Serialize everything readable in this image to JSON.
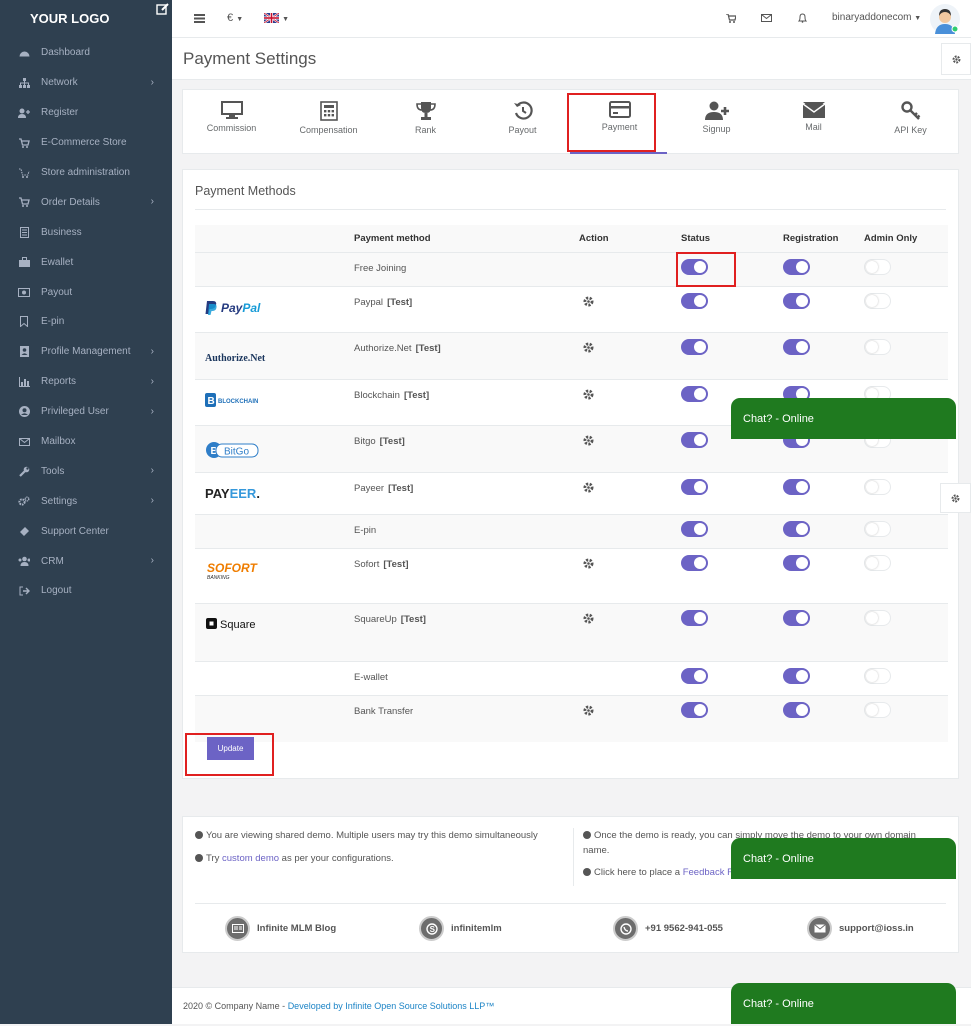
{
  "sidebar": {
    "logo": "YOUR LOGO",
    "items": [
      {
        "label": "Dashboard",
        "icon": "dashboard-icon",
        "chevron": false
      },
      {
        "label": "Network",
        "icon": "sitemap-icon",
        "chevron": true
      },
      {
        "label": "Register",
        "icon": "user-plus-icon",
        "chevron": false
      },
      {
        "label": "E-Commerce Store",
        "icon": "cart-icon",
        "chevron": false
      },
      {
        "label": "Store administration",
        "icon": "cart-arrow-icon",
        "chevron": false
      },
      {
        "label": "Order Details",
        "icon": "cart-icon",
        "chevron": true
      },
      {
        "label": "Business",
        "icon": "document-icon",
        "chevron": false
      },
      {
        "label": "Ewallet",
        "icon": "briefcase-icon",
        "chevron": false
      },
      {
        "label": "Payout",
        "icon": "money-icon",
        "chevron": false
      },
      {
        "label": "E-pin",
        "icon": "bookmark-icon",
        "chevron": false
      },
      {
        "label": "Profile Management",
        "icon": "id-card-icon",
        "chevron": true
      },
      {
        "label": "Reports",
        "icon": "bar-chart-icon",
        "chevron": true
      },
      {
        "label": "Privileged User",
        "icon": "user-circle-icon",
        "chevron": true
      },
      {
        "label": "Mailbox",
        "icon": "envelope-icon",
        "chevron": false
      },
      {
        "label": "Tools",
        "icon": "wrench-icon",
        "chevron": true
      },
      {
        "label": "Settings",
        "icon": "cogs-icon",
        "chevron": true
      },
      {
        "label": "Support Center",
        "icon": "ticket-icon",
        "chevron": false
      },
      {
        "label": "CRM",
        "icon": "users-icon",
        "chevron": true
      },
      {
        "label": "Logout",
        "icon": "sign-out-icon",
        "chevron": false
      }
    ]
  },
  "topbar": {
    "currency": "€",
    "username": "binaryaddonecom"
  },
  "page": {
    "title": "Payment Settings"
  },
  "tabs": [
    {
      "label": "Commission",
      "icon": "monitor-icon"
    },
    {
      "label": "Compensation",
      "icon": "calculator-icon"
    },
    {
      "label": "Rank",
      "icon": "trophy-icon"
    },
    {
      "label": "Payout",
      "icon": "history-icon"
    },
    {
      "label": "Payment",
      "icon": "credit-card-icon",
      "active": true
    },
    {
      "label": "Signup",
      "icon": "user-plus-icon"
    },
    {
      "label": "Mail",
      "icon": "envelope-icon"
    },
    {
      "label": "API Key",
      "icon": "key-icon"
    }
  ],
  "payment_methods": {
    "title": "Payment Methods",
    "columns": [
      "Payment method",
      "Action",
      "Status",
      "Registration",
      "Admin Only"
    ],
    "rows": [
      {
        "logo": "",
        "name": "Free Joining",
        "test": "",
        "gear": false,
        "status": true,
        "registration": true,
        "admin_only": false
      },
      {
        "logo": "PayPal",
        "name": "Paypal",
        "test": "[Test]",
        "gear": true,
        "status": true,
        "registration": true,
        "admin_only": false
      },
      {
        "logo": "Authorize.Net",
        "name": "Authorize.Net",
        "test": "[Test]",
        "gear": true,
        "status": true,
        "registration": true,
        "admin_only": false
      },
      {
        "logo": "BLOCKCHAIN",
        "name": "Blockchain",
        "test": "[Test]",
        "gear": true,
        "status": true,
        "registration": true,
        "admin_only": false
      },
      {
        "logo": "BitGo",
        "name": "Bitgo",
        "test": "[Test]",
        "gear": true,
        "status": true,
        "registration": true,
        "admin_only": false
      },
      {
        "logo": "PAYEER.",
        "name": "Payeer",
        "test": "[Test]",
        "gear": true,
        "status": true,
        "registration": true,
        "admin_only": false
      },
      {
        "logo": "",
        "name": "E-pin",
        "test": "",
        "gear": false,
        "status": true,
        "registration": true,
        "admin_only": false
      },
      {
        "logo": "SOFORT",
        "name": "Sofort",
        "test": "[Test]",
        "gear": true,
        "status": true,
        "registration": true,
        "admin_only": false
      },
      {
        "logo": "Square",
        "name": "SquareUp",
        "test": "[Test]",
        "gear": true,
        "status": true,
        "registration": true,
        "admin_only": false
      },
      {
        "logo": "",
        "name": "E-wallet",
        "test": "",
        "gear": false,
        "status": true,
        "registration": true,
        "admin_only": false
      },
      {
        "logo": "",
        "name": "Bank Transfer",
        "test": "",
        "gear": true,
        "status": true,
        "registration": true,
        "admin_only": false
      }
    ],
    "update_label": "Update"
  },
  "info": {
    "line1": "You are viewing shared demo. Multiple users may try this demo simultaneously",
    "line2_pre": "Try ",
    "line2_link": "custom demo",
    "line2_post": " as per your configurations.",
    "line3": "Once the demo is ready, you can simply move the demo to your own domain name.",
    "line4_pre": "Click here to place a ",
    "line4_link": "Feedback F"
  },
  "social": [
    {
      "label": "Infinite MLM Blog",
      "icon": "blog-icon"
    },
    {
      "label": "infinitemlm",
      "icon": "skype-icon"
    },
    {
      "label": "+91 9562-941-055",
      "icon": "whatsapp-icon"
    },
    {
      "label": "support@ioss.in",
      "icon": "mail-icon"
    }
  ],
  "footer": {
    "text": "2020 © Company Name - ",
    "link": "Developed by Infinite Open Source Solutions LLP™"
  },
  "chat": {
    "label": "Chat? - Online"
  },
  "colors": {
    "sidebar": "#2f4050",
    "accent": "#6c63c5",
    "chat": "#1f7a1f",
    "highlight": "#e02020"
  }
}
